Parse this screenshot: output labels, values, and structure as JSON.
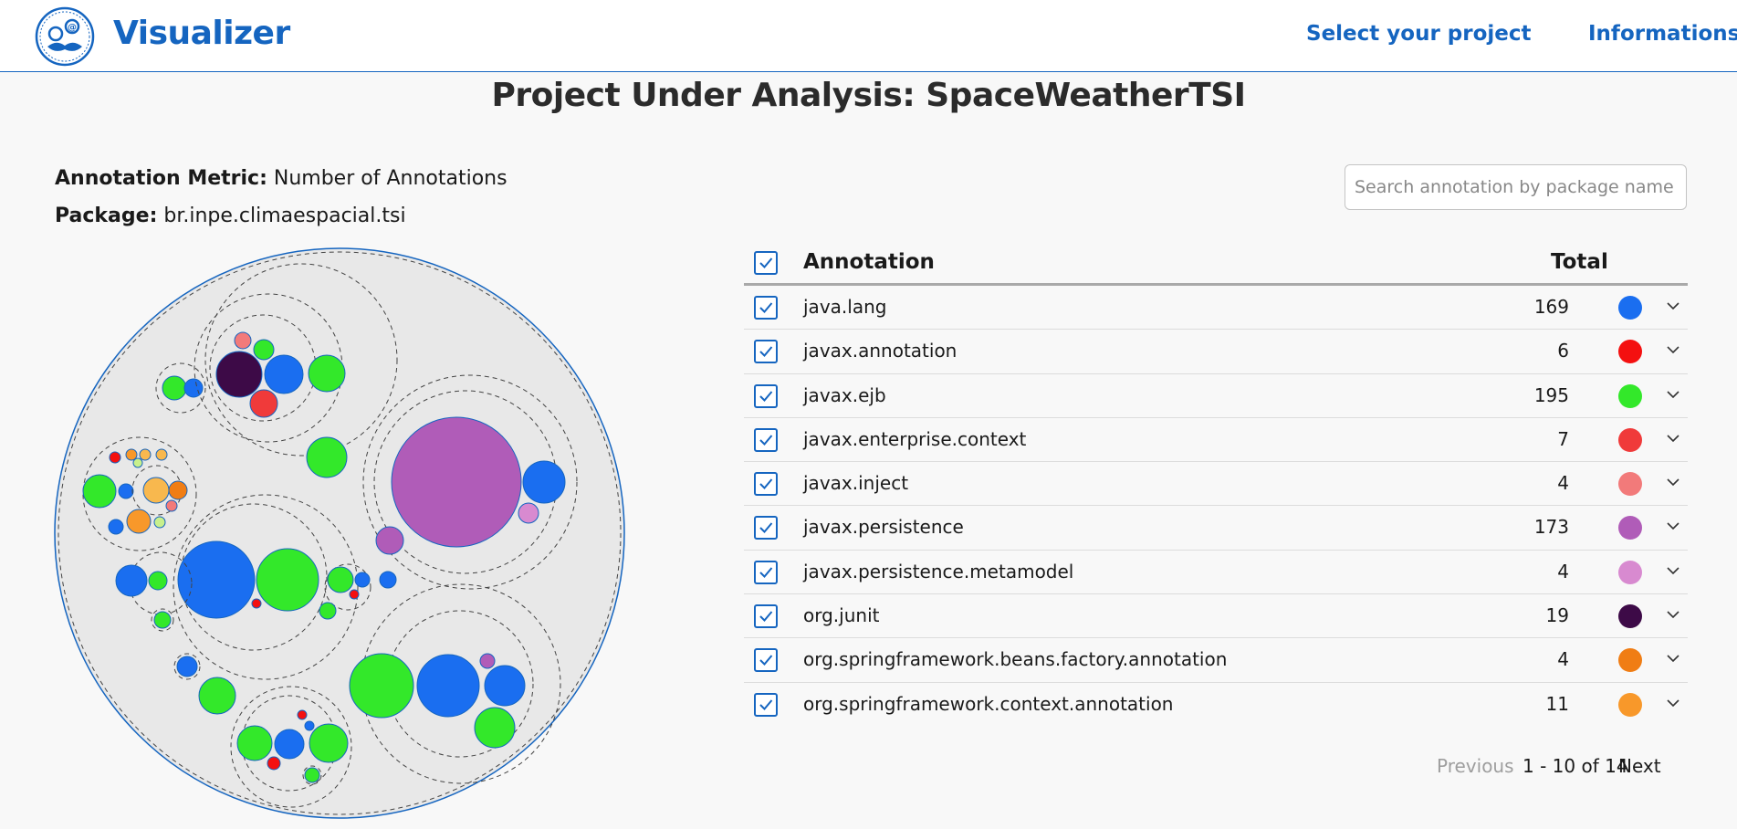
{
  "app": {
    "brand": "Visualizer"
  },
  "nav": {
    "select_project": "Select your project",
    "informations": "Informations"
  },
  "page": {
    "title": "Project Under Analysis: SpaceWeatherTSI"
  },
  "meta": {
    "metric_label": "Annotation Metric:",
    "metric_value": "Number of Annotations",
    "package_label": "Package:",
    "package_value": "br.inpe.climaespacial.tsi"
  },
  "search": {
    "placeholder": "Search annotation by package name",
    "value": ""
  },
  "table": {
    "headers": {
      "annotation": "Annotation",
      "total": "Total"
    },
    "select_all_checked": true,
    "rows": [
      {
        "name": "java.lang",
        "total": "169",
        "color": "#1a6ef0",
        "checked": true
      },
      {
        "name": "javax.annotation",
        "total": "6",
        "color": "#f41010",
        "checked": true
      },
      {
        "name": "javax.ejb",
        "total": "195",
        "color": "#33e82a",
        "checked": true
      },
      {
        "name": "javax.enterprise.context",
        "total": "7",
        "color": "#f03a3a",
        "checked": true
      },
      {
        "name": "javax.inject",
        "total": "4",
        "color": "#f27a7a",
        "checked": true
      },
      {
        "name": "javax.persistence",
        "total": "173",
        "color": "#b05cb8",
        "checked": true
      },
      {
        "name": "javax.persistence.metamodel",
        "total": "4",
        "color": "#d88ad0",
        "checked": true
      },
      {
        "name": "org.junit",
        "total": "19",
        "color": "#3d0a47",
        "checked": true
      },
      {
        "name": "org.springframework.beans.factory.annotation",
        "total": "4",
        "color": "#f07d14",
        "checked": true
      },
      {
        "name": "org.springframework.context.annotation",
        "total": "11",
        "color": "#f8982a",
        "checked": true
      }
    ]
  },
  "pagination": {
    "previous": "Previous",
    "range": "1 - 10 of 14",
    "next": "Next"
  },
  "colors": {
    "accent": "#1565c0",
    "bubble_background": "#e8e8e8",
    "legend": {
      "blue": "#1a6ef0",
      "red": "#f41010",
      "green": "#33e82a",
      "red2": "#f03a3a",
      "salmon": "#f27a7a",
      "purple": "#b05cb8",
      "pink": "#d88ad0",
      "dark": "#3d0a47",
      "orange": "#f07d14",
      "orange2": "#f8982a",
      "light_orange": "#f8b84e",
      "pale_green": "#c8f08c"
    }
  }
}
